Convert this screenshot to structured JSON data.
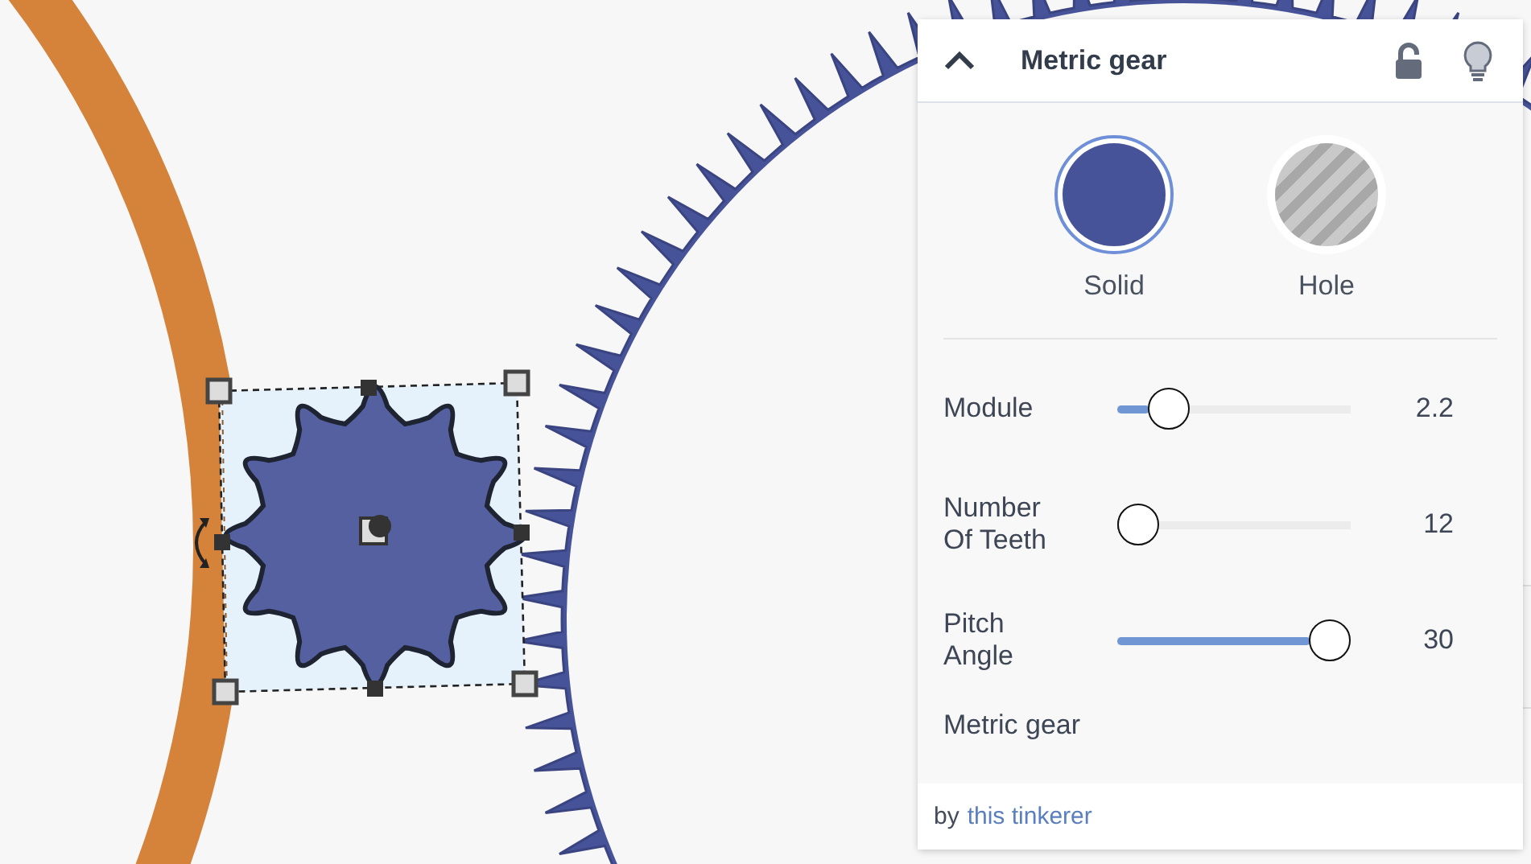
{
  "panel": {
    "title": "Metric gear",
    "expanded": true,
    "locked": false,
    "shape_types": [
      {
        "kind": "solid",
        "label": "Solid",
        "selected": true
      },
      {
        "kind": "hole",
        "label": "Hole",
        "selected": false
      }
    ],
    "parameters": [
      {
        "label": "Module",
        "level": 0.16,
        "value": "2.2"
      },
      {
        "label": "Number Of Teeth",
        "level": 0.0,
        "value": "12"
      },
      {
        "label": "Pitch Angle",
        "level": 1.0,
        "value": "30"
      }
    ],
    "description": "Metric gear",
    "author_prefix": "by",
    "author": "this tinkerer"
  }
}
